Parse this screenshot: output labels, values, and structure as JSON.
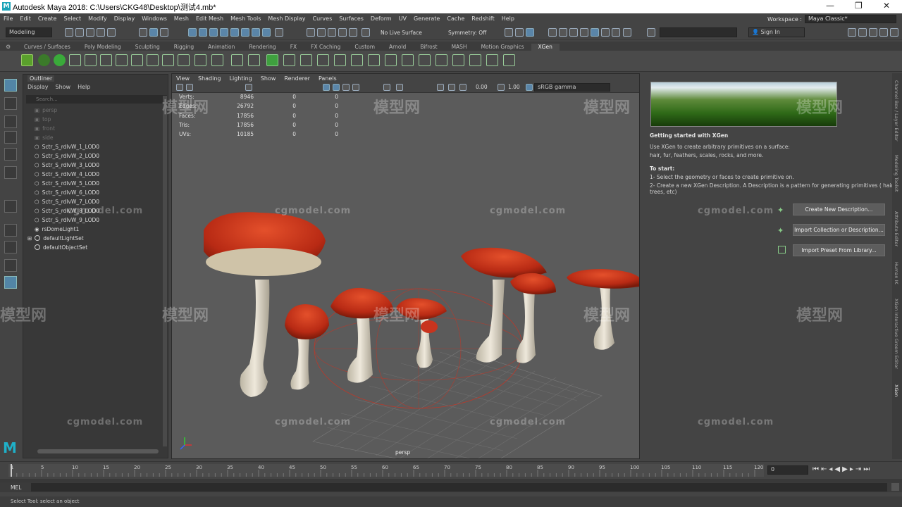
{
  "window": {
    "title": "Autodesk Maya 2018: C:\\Users\\CKG48\\Desktop\\测试4.mb*",
    "logo": "M"
  },
  "menubar": {
    "items": [
      "File",
      "Edit",
      "Create",
      "Select",
      "Modify",
      "Display",
      "Windows",
      "Mesh",
      "Edit Mesh",
      "Mesh Tools",
      "Mesh Display",
      "Curves",
      "Surfaces",
      "Deform",
      "UV",
      "Generate",
      "Cache",
      "Redshift",
      "Help"
    ],
    "workspace_label": "Workspace :",
    "workspace_value": "Maya Classic*"
  },
  "toolbar": {
    "mode": "Modeling",
    "live_surface": "No Live Surface",
    "symmetry": "Symmetry: Off",
    "sign_in": "Sign In"
  },
  "shelf_tabs": [
    "Curves / Surfaces",
    "Poly Modeling",
    "Sculpting",
    "Rigging",
    "Animation",
    "Rendering",
    "FX",
    "FX Caching",
    "Custom",
    "Arnold",
    "Bifrost",
    "MASH",
    "Motion Graphics",
    "XGen"
  ],
  "shelf_active": "XGen",
  "outliner": {
    "title": "Outliner",
    "menu": [
      "Display",
      "Show",
      "Help"
    ],
    "search_placeholder": "Search...",
    "items": [
      {
        "label": "persp",
        "dim": true
      },
      {
        "label": "top",
        "dim": true
      },
      {
        "label": "front",
        "dim": true
      },
      {
        "label": "side",
        "dim": true
      },
      {
        "label": "Sctr_S_rdlvW_1_LOD0",
        "dim": false
      },
      {
        "label": "Sctr_S_rdlvW_2_LOD0",
        "dim": false
      },
      {
        "label": "Sctr_S_rdlvW_3_LOD0",
        "dim": false
      },
      {
        "label": "Sctr_S_rdlvW_4_LOD0",
        "dim": false
      },
      {
        "label": "Sctr_S_rdlvW_5_LOD0",
        "dim": false
      },
      {
        "label": "Sctr_S_rdlvW_6_LOD0",
        "dim": false
      },
      {
        "label": "Sctr_S_rdlvW_7_LOD0",
        "dim": false
      },
      {
        "label": "Sctr_S_rdlvW_8_LOD0",
        "dim": false
      },
      {
        "label": "Sctr_S_rdlvW_9_LOD0",
        "dim": false
      },
      {
        "label": "rsDomeLight1",
        "dim": false
      },
      {
        "label": "defaultLightSet",
        "dim": false
      },
      {
        "label": "defaultObjectSet",
        "dim": false
      }
    ]
  },
  "viewport": {
    "menu": [
      "View",
      "Shading",
      "Lighting",
      "Show",
      "Renderer",
      "Panels"
    ],
    "exposure": "0.00",
    "gamma": "1.00",
    "color_space": "sRGB gamma",
    "camera": "persp",
    "stats": [
      {
        "label": "Verts:",
        "v1": "8946",
        "v2": "0",
        "v3": "0"
      },
      {
        "label": "Edges:",
        "v1": "26792",
        "v2": "0",
        "v3": "0"
      },
      {
        "label": "Faces:",
        "v1": "17856",
        "v2": "0",
        "v3": "0"
      },
      {
        "label": "Tris:",
        "v1": "17856",
        "v2": "0",
        "v3": "0"
      },
      {
        "label": "UVs:",
        "v1": "10185",
        "v2": "0",
        "v3": "0"
      }
    ]
  },
  "xgen_panel": {
    "heading": "Getting started with XGen",
    "intro1": "Use XGen to create arbitrary primitives on a surface:",
    "intro2": "hair, fur, feathers, scales, rocks, and more.",
    "to_start": "To start:",
    "step1": "1- Select the geometry or faces to create primitive on.",
    "step2a": "2- Create a new XGen Description. A Description is a pattern for generating primitives ( hair, rocks,",
    "step2b": "trees, etc)",
    "btn_create": "Create New Description...",
    "btn_import_collection": "Import Collection or Description...",
    "btn_import_preset": "Import Preset From Library..."
  },
  "right_strip": [
    "Channel Box / Layer Editor",
    "Modeling Toolkit",
    "Attribute Editor",
    "Human IK",
    "XGen Interactive Groom Editor",
    "XGen"
  ],
  "timeline": {
    "ticks": [
      "1",
      "5",
      "10",
      "15",
      "20",
      "25",
      "30",
      "35",
      "40",
      "45",
      "50",
      "55",
      "60",
      "65",
      "70",
      "75",
      "80",
      "85",
      "90",
      "95",
      "100",
      "105",
      "110",
      "115",
      "120"
    ],
    "current_frame": "0"
  },
  "command_line": {
    "label": "MEL"
  },
  "status": {
    "help_line": "Select Tool: select an object"
  },
  "watermark": {
    "en": "cgmodel.com",
    "cn": "模型网"
  },
  "colors": {
    "accent": "#5285a6",
    "mushroom_cap": "#c8341e",
    "mushroom_stem": "#e2dccd"
  }
}
